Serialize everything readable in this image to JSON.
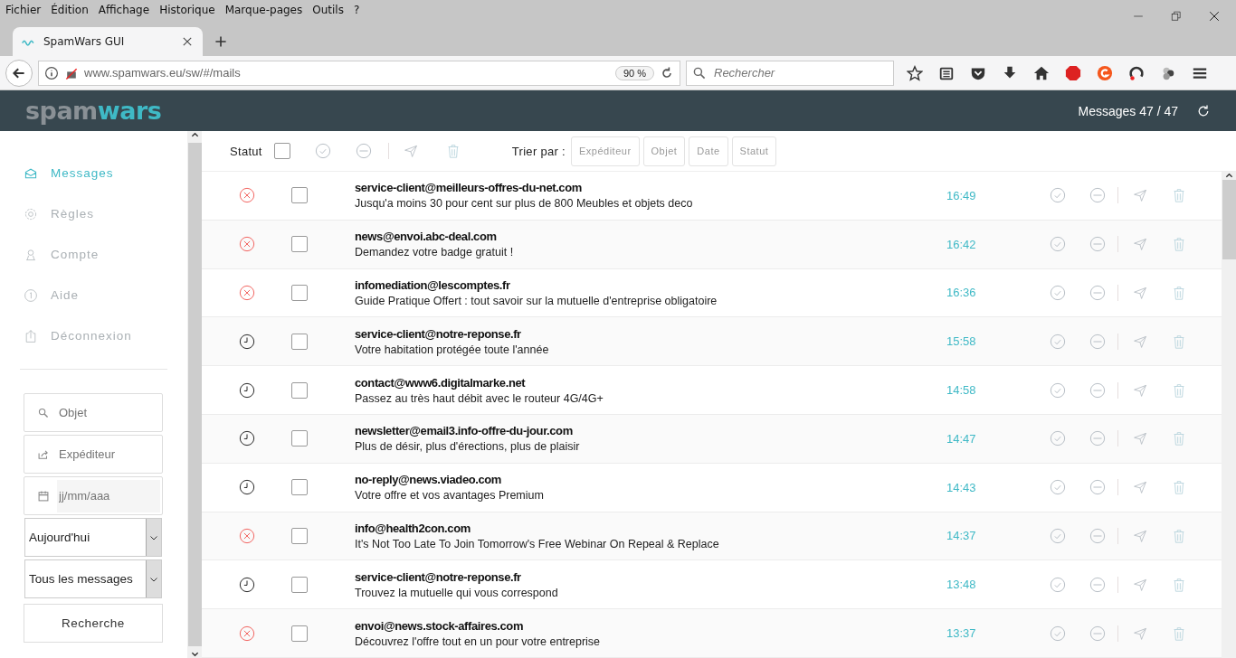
{
  "menu_bar": [
    "Fichier",
    "Édition",
    "Affichage",
    "Historique",
    "Marque-pages",
    "Outils",
    "?"
  ],
  "tab": {
    "title": "SpamWars GUI",
    "selected": true
  },
  "nav": {
    "url": "www.spamwars.eu/sw/#/mails",
    "zoom": "90 %",
    "search_placeholder": "Rechercher"
  },
  "header": {
    "logo": [
      "spam",
      "wars"
    ],
    "count": "Messages 47 / 47"
  },
  "sidebar": {
    "items": [
      {
        "label": "Messages",
        "selected": true
      },
      {
        "label": "Règles",
        "selected": false
      },
      {
        "label": "Compte",
        "selected": false
      },
      {
        "label": "Aide",
        "selected": false
      },
      {
        "label": "Déconnexion",
        "selected": false
      }
    ],
    "filters": [
      {
        "kind": "text",
        "placeholder": "Objet"
      },
      {
        "kind": "text",
        "placeholder": "Expéditeur"
      },
      {
        "kind": "date",
        "placeholder": "jj/mm/aaa"
      },
      {
        "kind": "select",
        "value": "Aujourd'hui"
      },
      {
        "kind": "select",
        "value": "Tous les messages"
      }
    ],
    "search_button": "Recherche"
  },
  "toolbar": {
    "status_label": "Statut",
    "select_all_checked": false,
    "sort_label": "Trier par :",
    "sort_buttons": [
      "Expéditeur",
      "Objet",
      "Date",
      "Statut"
    ]
  },
  "messages": [
    {
      "kind": "rejected",
      "checked": false,
      "sender": "service-client@meilleurs-offres-du-net.com",
      "subject": "Jusqu'a moins 30 pour cent sur plus de 800 Meubles et objets deco",
      "time": "16:49"
    },
    {
      "kind": "rejected",
      "checked": false,
      "sender": "news@envoi.abc-deal.com",
      "subject": "Demandez votre badge gratuit !",
      "time": "16:42"
    },
    {
      "kind": "rejected",
      "checked": false,
      "sender": "infomediation@lescomptes.fr",
      "subject": "Guide Pratique Offert : tout savoir sur la mutuelle d'entreprise obligatoire",
      "time": "16:36"
    },
    {
      "kind": "pending",
      "checked": false,
      "sender": "service-client@notre-reponse.fr",
      "subject": "Votre habitation protégée toute l'année",
      "time": "15:58"
    },
    {
      "kind": "pending",
      "checked": false,
      "sender": "contact@www6.digitalmarke.net",
      "subject": "Passez au très haut débit avec le routeur 4G/4G+",
      "time": "14:58"
    },
    {
      "kind": "pending",
      "checked": false,
      "sender": "newsletter@email3.info-offre-du-jour.com",
      "subject": "Plus de désir, plus d'érections, plus de plaisir",
      "time": "14:47"
    },
    {
      "kind": "pending",
      "checked": false,
      "sender": "no-reply@news.viadeo.com",
      "subject": "Votre offre et vos avantages Premium",
      "time": "14:43"
    },
    {
      "kind": "rejected",
      "checked": false,
      "sender": "info@health2con.com",
      "subject": "It's Not Too Late To Join Tomorrow's Free Webinar On Repeal & Replace",
      "time": "14:37"
    },
    {
      "kind": "pending",
      "checked": false,
      "sender": "service-client@notre-reponse.fr",
      "subject": "Trouvez la mutuelle qui vous correspond",
      "time": "13:48"
    },
    {
      "kind": "rejected",
      "checked": false,
      "sender": "envoi@news.stock-affaires.com",
      "subject": "Découvrez l'offre tout en un pour votre entreprise",
      "time": "13:37"
    }
  ]
}
